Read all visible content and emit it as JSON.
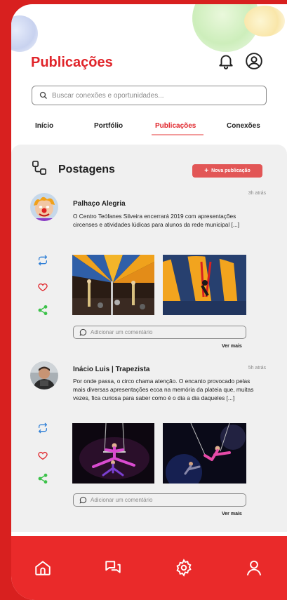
{
  "header": {
    "title": "Publicações"
  },
  "search": {
    "placeholder": "Buscar conexões e oportunidades..."
  },
  "tabs": [
    {
      "label": "Início"
    },
    {
      "label": "Portfólio"
    },
    {
      "label": "Publicações"
    },
    {
      "label": "Conexões"
    }
  ],
  "section": {
    "title": "Postagens",
    "new_post_label": "Nova publicação"
  },
  "posts": [
    {
      "author": "Palhaço Alegria",
      "time": "3h atrás",
      "text": "O Centro Teófanes Silveira encerrará 2019 com apresentações circenses e atividades lúdicas para alunos da rede municipal [...]",
      "comment_placeholder": "Adicionar um comentário",
      "more_label": "Ver mais"
    },
    {
      "author": "Inácio Luis | Trapezista",
      "time": "5h atrás",
      "text": "Por onde passa, o circo chama atenção. O encanto provocado pelas mais diversas apresentações ecoa na memória da plateia que, muitas vezes, fica curiosa para saber como é o dia a dia daqueles [...]",
      "comment_placeholder": "Adicionar um comentário",
      "more_label": "Ver mais"
    }
  ],
  "colors": {
    "accent": "#e0242a",
    "nav_bg": "#ea2a2a",
    "button": "#e25656",
    "share": "#3cc24a",
    "repost": "#2f7fd6"
  }
}
